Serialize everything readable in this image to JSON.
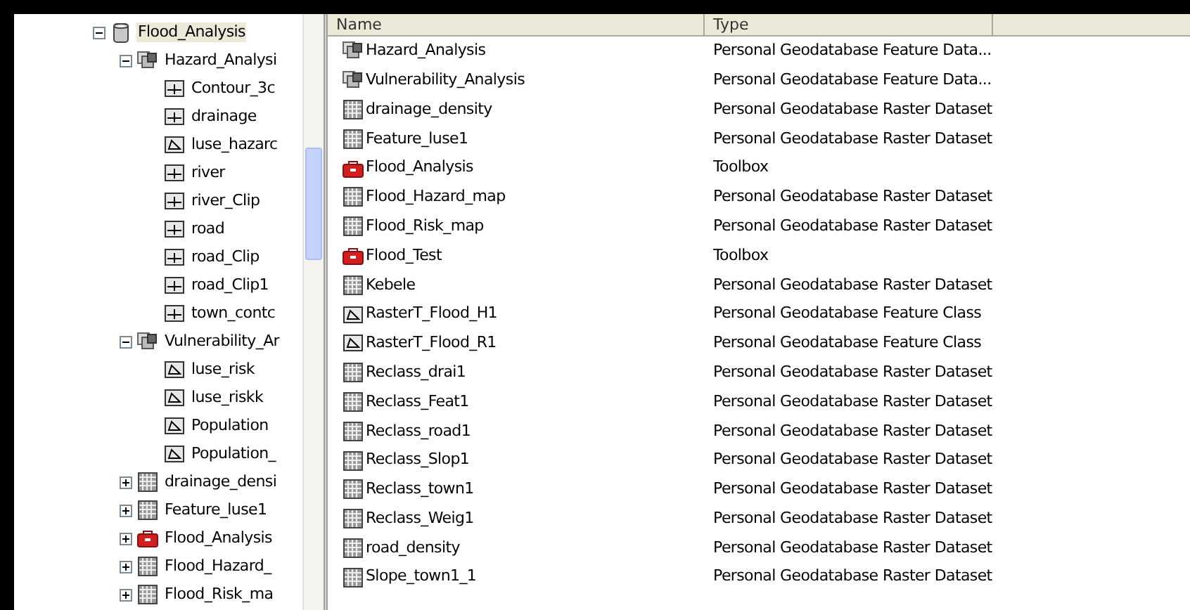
{
  "tree": [
    {
      "label": "Flood_Analysis",
      "kind": "geodatabase",
      "selected": true,
      "expanded": true,
      "children": [
        {
          "label": "Hazard_Analysi",
          "kind": "dataset",
          "selected": false,
          "expanded": true,
          "children": [
            {
              "label": "Contour_3c",
              "kind": "line",
              "selected": false
            },
            {
              "label": "drainage",
              "kind": "line",
              "selected": false
            },
            {
              "label": "luse_hazarc",
              "kind": "polygon",
              "selected": false
            },
            {
              "label": "river",
              "kind": "line",
              "selected": false
            },
            {
              "label": "river_Clip",
              "kind": "line",
              "selected": false
            },
            {
              "label": "road",
              "kind": "line",
              "selected": false
            },
            {
              "label": "road_Clip",
              "kind": "line",
              "selected": false
            },
            {
              "label": "road_Clip1",
              "kind": "line",
              "selected": false
            },
            {
              "label": "town_contc",
              "kind": "line",
              "selected": false
            }
          ]
        },
        {
          "label": "Vulnerability_Ar",
          "kind": "dataset",
          "selected": false,
          "expanded": true,
          "children": [
            {
              "label": "luse_risk",
              "kind": "polygon",
              "selected": false
            },
            {
              "label": "luse_riskk",
              "kind": "polygon",
              "selected": false
            },
            {
              "label": "Population",
              "kind": "polygon",
              "selected": false
            },
            {
              "label": "Population_",
              "kind": "polygon",
              "selected": false
            }
          ]
        },
        {
          "label": "drainage_densi",
          "kind": "raster",
          "selected": false,
          "expanded": false
        },
        {
          "label": "Feature_luse1",
          "kind": "raster",
          "selected": false,
          "expanded": false
        },
        {
          "label": "Flood_Analysis",
          "kind": "toolbox",
          "selected": false,
          "expanded": false
        },
        {
          "label": "Flood_Hazard_",
          "kind": "raster",
          "selected": false,
          "expanded": false
        },
        {
          "label": "Flood_Risk_ma",
          "kind": "raster",
          "selected": false,
          "expanded": false
        }
      ]
    }
  ],
  "table": {
    "columns": [
      "Name",
      "Type"
    ],
    "rows": [
      {
        "name": "Hazard_Analysis",
        "kind": "dataset",
        "type": "Personal Geodatabase Feature Data..."
      },
      {
        "name": "Vulnerability_Analysis",
        "kind": "dataset",
        "type": "Personal Geodatabase Feature Data..."
      },
      {
        "name": "drainage_density",
        "kind": "raster",
        "type": "Personal Geodatabase Raster Dataset"
      },
      {
        "name": "Feature_luse1",
        "kind": "raster",
        "type": "Personal Geodatabase Raster Dataset"
      },
      {
        "name": "Flood_Analysis",
        "kind": "toolbox",
        "type": "Toolbox"
      },
      {
        "name": "Flood_Hazard_map",
        "kind": "raster",
        "type": "Personal Geodatabase Raster Dataset"
      },
      {
        "name": "Flood_Risk_map",
        "kind": "raster",
        "type": "Personal Geodatabase Raster Dataset"
      },
      {
        "name": "Flood_Test",
        "kind": "toolbox",
        "type": "Toolbox"
      },
      {
        "name": "Kebele",
        "kind": "raster",
        "type": "Personal Geodatabase Raster Dataset"
      },
      {
        "name": "RasterT_Flood_H1",
        "kind": "polygon",
        "type": "Personal Geodatabase Feature Class"
      },
      {
        "name": "RasterT_Flood_R1",
        "kind": "polygon",
        "type": "Personal Geodatabase Feature Class"
      },
      {
        "name": "Reclass_drai1",
        "kind": "raster",
        "type": "Personal Geodatabase Raster Dataset"
      },
      {
        "name": "Reclass_Feat1",
        "kind": "raster",
        "type": "Personal Geodatabase Raster Dataset"
      },
      {
        "name": "Reclass_road1",
        "kind": "raster",
        "type": "Personal Geodatabase Raster Dataset"
      },
      {
        "name": "Reclass_Slop1",
        "kind": "raster",
        "type": "Personal Geodatabase Raster Dataset"
      },
      {
        "name": "Reclass_town1",
        "kind": "raster",
        "type": "Personal Geodatabase Raster Dataset"
      },
      {
        "name": "Reclass_Weig1",
        "kind": "raster",
        "type": "Personal Geodatabase Raster Dataset"
      },
      {
        "name": "road_density",
        "kind": "raster",
        "type": "Personal Geodatabase Raster Dataset"
      },
      {
        "name": "Slope_town1_1",
        "kind": "raster",
        "type": "Personal Geodatabase Raster Dataset"
      }
    ]
  }
}
